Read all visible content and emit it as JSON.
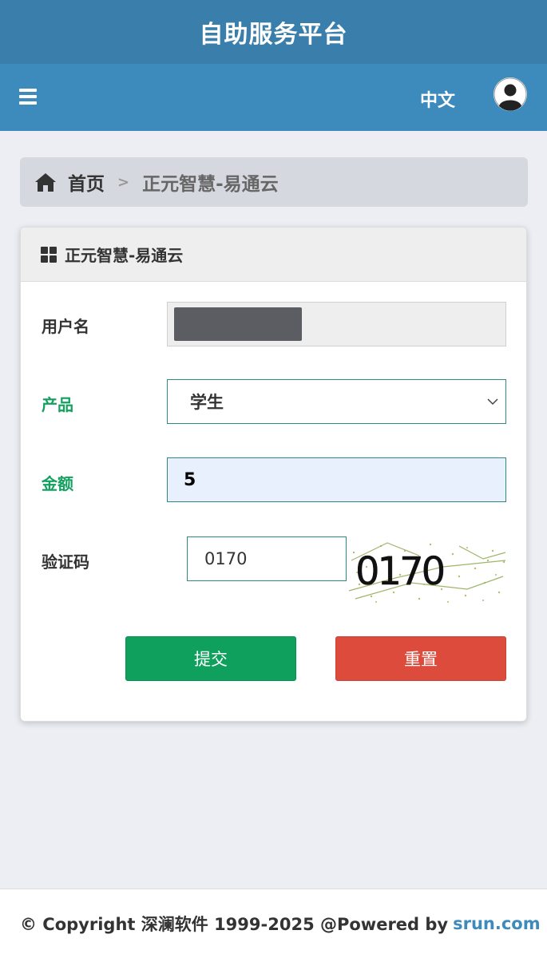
{
  "header": {
    "title": "自助服务平台"
  },
  "nav": {
    "menu_icon": "hamburger-icon",
    "language": "中文",
    "avatar_icon": "user-avatar-icon"
  },
  "breadcrumb": {
    "home_icon": "home-icon",
    "home": "首页",
    "separator": ">",
    "current": "正元智慧-易通云"
  },
  "panel": {
    "title_icon": "grid-icon",
    "title": "正元智慧-易通云",
    "fields": {
      "username": {
        "label": "用户名",
        "value": ""
      },
      "product": {
        "label": "产品",
        "value": "学生"
      },
      "amount": {
        "label": "金额",
        "value": "5"
      },
      "captcha": {
        "label": "验证码",
        "value": "0170",
        "image_text": "0170"
      }
    },
    "buttons": {
      "submit": "提交",
      "reset": "重置"
    }
  },
  "footer": {
    "copyright": "© Copyright 深澜软件 1999-2025 @Powered by",
    "link": "srun.com"
  },
  "colors": {
    "title_bar": "#3a7fac",
    "nav_bar": "#3d8bbd",
    "submit": "#0ea05c",
    "reset": "#dd4b3d",
    "accent_label": "#13a05f"
  }
}
